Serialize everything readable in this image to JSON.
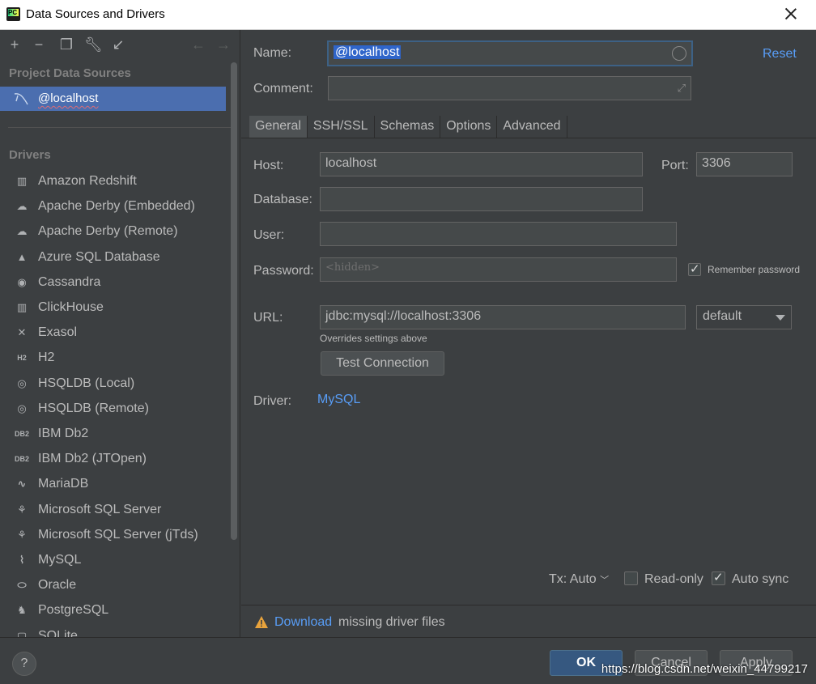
{
  "window": {
    "title": "Data Sources and Drivers"
  },
  "sidebar": {
    "project_title": "Project Data Sources",
    "selected_source": "@localhost",
    "drivers_title": "Drivers",
    "drivers": [
      {
        "label": "Amazon Redshift",
        "icon": "redshift-icon",
        "glyph": "▥"
      },
      {
        "label": "Apache Derby (Embedded)",
        "icon": "derby-icon",
        "glyph": "☁"
      },
      {
        "label": "Apache Derby (Remote)",
        "icon": "derby-icon",
        "glyph": "☁"
      },
      {
        "label": "Azure SQL Database",
        "icon": "azure-icon",
        "glyph": "▲"
      },
      {
        "label": "Cassandra",
        "icon": "cassandra-icon",
        "glyph": "◉"
      },
      {
        "label": "ClickHouse",
        "icon": "clickhouse-icon",
        "glyph": "▥"
      },
      {
        "label": "Exasol",
        "icon": "exasol-icon",
        "glyph": "✕"
      },
      {
        "label": "H2",
        "icon": "h2-icon",
        "glyph": "H2"
      },
      {
        "label": "HSQLDB (Local)",
        "icon": "hsqldb-icon",
        "glyph": "◎"
      },
      {
        "label": "HSQLDB (Remote)",
        "icon": "hsqldb-icon",
        "glyph": "◎"
      },
      {
        "label": "IBM Db2",
        "icon": "ibm-db2-icon",
        "glyph": "DB2"
      },
      {
        "label": "IBM Db2 (JTOpen)",
        "icon": "ibm-db2-icon",
        "glyph": "DB2"
      },
      {
        "label": "MariaDB",
        "icon": "mariadb-icon",
        "glyph": "∿"
      },
      {
        "label": "Microsoft SQL Server",
        "icon": "mssql-icon",
        "glyph": "⚘"
      },
      {
        "label": "Microsoft SQL Server (jTds)",
        "icon": "mssql-icon",
        "glyph": "⚘"
      },
      {
        "label": "MySQL",
        "icon": "mysql-icon",
        "glyph": "⌇"
      },
      {
        "label": "Oracle",
        "icon": "oracle-icon",
        "glyph": "⬭"
      },
      {
        "label": "PostgreSQL",
        "icon": "postgresql-icon",
        "glyph": "♞"
      },
      {
        "label": "SQLite",
        "icon": "sqlite-icon",
        "glyph": "▢"
      }
    ]
  },
  "form": {
    "name_label": "Name:",
    "name_value": "@localhost",
    "reset_label": "Reset",
    "comment_label": "Comment:",
    "comment_value": "",
    "tabs": [
      "General",
      "SSH/SSL",
      "Schemas",
      "Options",
      "Advanced"
    ],
    "host_label": "Host:",
    "host_value": "localhost",
    "port_label": "Port:",
    "port_value": "3306",
    "database_label": "Database:",
    "database_value": "",
    "user_label": "User:",
    "user_value": "",
    "password_label": "Password:",
    "password_placeholder": "<hidden>",
    "remember_password": "Remember password",
    "url_label": "URL:",
    "url_value": "jdbc:mysql://localhost:3306",
    "url_mode": "default",
    "url_hint": "Overrides settings above",
    "test_connection": "Test Connection",
    "driver_label": "Driver:",
    "driver_value": "MySQL",
    "tx_label": "Tx: Auto",
    "readonly_label": "Read-only",
    "readonly_checked": false,
    "autosync_label": "Auto sync",
    "autosync_checked": true,
    "warning_link": "Download",
    "warning_text": "missing driver files"
  },
  "footer": {
    "help": "?",
    "ok": "OK",
    "cancel": "Cancel",
    "apply": "Apply",
    "watermark": "https://blog.csdn.net/weixin_44799217"
  },
  "colors": {
    "accent": "#4b6eaf",
    "link": "#589df6",
    "warning": "#e8a33c"
  }
}
